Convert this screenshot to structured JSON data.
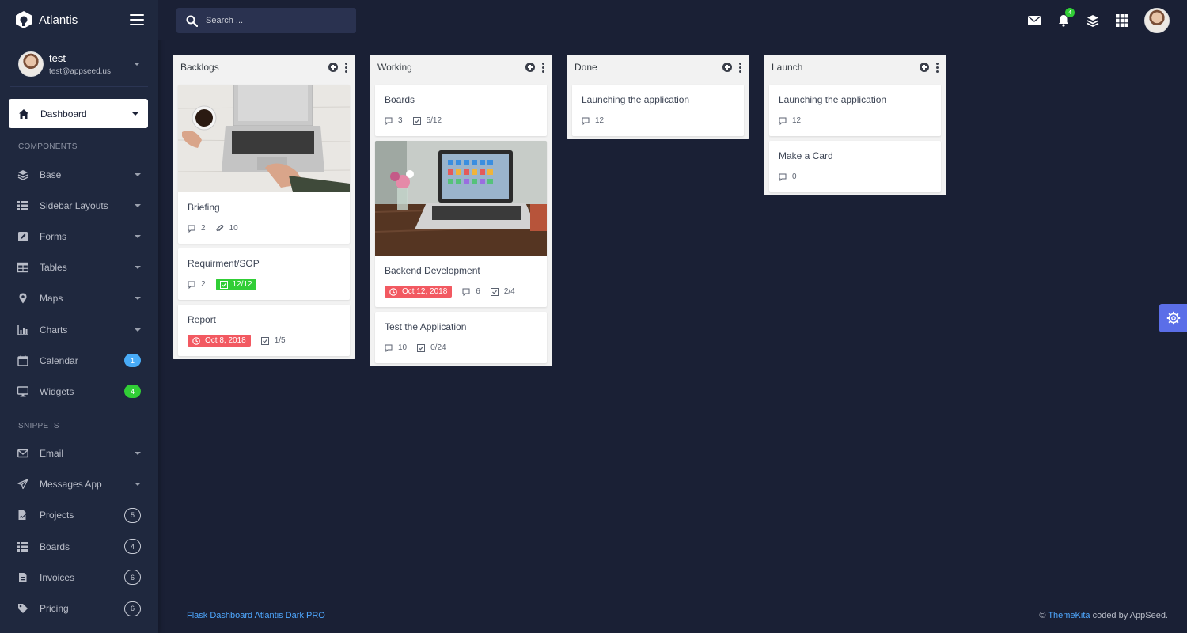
{
  "app": {
    "name": "Atlantis"
  },
  "user": {
    "name": "test",
    "email": "test@appseed.us"
  },
  "search": {
    "placeholder": "Search ..."
  },
  "header": {
    "notification_count": "4"
  },
  "nav": {
    "active": {
      "label": "Dashboard"
    },
    "sections": [
      {
        "title": "COMPONENTS"
      },
      {
        "title": "SNIPPETS"
      }
    ],
    "components": [
      {
        "label": "Base",
        "icon": "layers-icon"
      },
      {
        "label": "Sidebar Layouts",
        "icon": "th-list-icon"
      },
      {
        "label": "Forms",
        "icon": "pen-square-icon"
      },
      {
        "label": "Tables",
        "icon": "table-icon"
      },
      {
        "label": "Maps",
        "icon": "map-marker-icon"
      },
      {
        "label": "Charts",
        "icon": "bar-chart-icon"
      },
      {
        "label": "Calendar",
        "icon": "calendar-icon",
        "badge": "1"
      },
      {
        "label": "Widgets",
        "icon": "desktop-icon",
        "badge": "4"
      }
    ],
    "snippets": [
      {
        "label": "Email",
        "icon": "envelope-icon"
      },
      {
        "label": "Messages App",
        "icon": "paper-plane-icon"
      },
      {
        "label": "Projects",
        "icon": "file-signature-icon",
        "badge": "5"
      },
      {
        "label": "Boards",
        "icon": "th-list-icon",
        "badge": "4"
      },
      {
        "label": "Invoices",
        "icon": "file-invoice-icon",
        "badge": "6"
      },
      {
        "label": "Pricing",
        "icon": "tag-icon",
        "badge": "6"
      }
    ]
  },
  "board": {
    "columns": [
      {
        "title": "Backlogs",
        "cards": [
          {
            "title": "Briefing",
            "comments": "2",
            "attachments": "10"
          },
          {
            "title": "Requirment/SOP",
            "comments": "2",
            "checklist": "12/12"
          },
          {
            "title": "Report",
            "due": "Oct 8, 2018",
            "checklist": "1/5"
          }
        ]
      },
      {
        "title": "Working",
        "cards": [
          {
            "title": "Boards",
            "comments": "3",
            "checklist": "5/12"
          },
          {
            "title": "Backend Development",
            "due": "Oct 12, 2018",
            "comments": "6",
            "checklist": "2/4"
          },
          {
            "title": "Test the Application",
            "comments": "10",
            "checklist": "0/24"
          }
        ]
      },
      {
        "title": "Done",
        "cards": [
          {
            "title": "Launching the application",
            "comments": "12"
          }
        ]
      },
      {
        "title": "Launch",
        "cards": [
          {
            "title": "Launching the application",
            "comments": "12"
          },
          {
            "title": "Make a Card",
            "comments": "0"
          }
        ]
      }
    ]
  },
  "footer": {
    "left": "Flask Dashboard Atlantis Dark PRO",
    "copyright": "©",
    "link": "ThemeKita",
    "suffix": "coded by AppSeed."
  },
  "colors": {
    "background": "#1a2035",
    "sidebar": "#1f283e",
    "accent": "#5b6ee8",
    "success": "#31ce36",
    "danger": "#f25961",
    "info": "#48abf7"
  }
}
